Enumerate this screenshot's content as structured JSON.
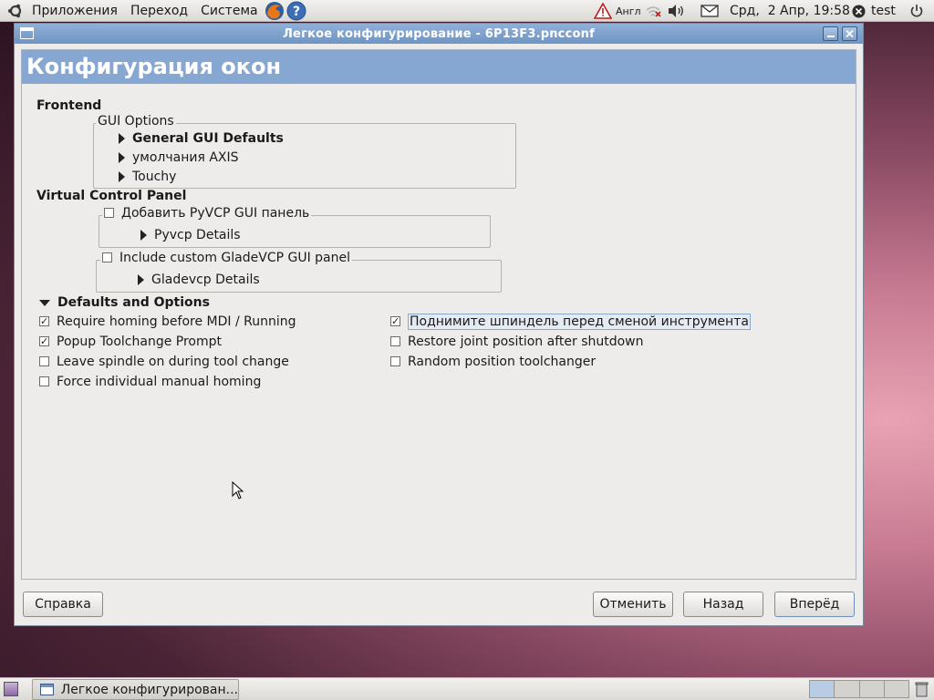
{
  "top_panel": {
    "menus": [
      "Приложения",
      "Переход",
      "Система"
    ],
    "keyboard_layout": "Англ",
    "datetime": "Срд,  2 Апр, 19:58",
    "user": "test"
  },
  "window": {
    "title": "Легкое конфигурирование - 6P13F3.pncconf",
    "page_title": "Конфигурация окон",
    "frontend": {
      "heading": "Frontend",
      "gui_options_label": "GUI Options",
      "expanders": [
        "General GUI Defaults",
        "умолчания AXIS",
        "Touchy"
      ]
    },
    "vcp": {
      "heading": "Virtual Control Panel",
      "pyvcp_check_label": "Добавить PyVCP GUI панель",
      "pyvcp_details": "Pyvcp Details",
      "gladevcp_check_label": "Include custom GladeVCP GUI panel",
      "gladevcp_details": "Gladevcp Details"
    },
    "defaults": {
      "heading": "Defaults and Options",
      "left_options": [
        {
          "label": "Require homing before MDI / Running",
          "checked": true
        },
        {
          "label": "Popup Toolchange Prompt",
          "checked": true
        },
        {
          "label": "Leave spindle on during tool change",
          "checked": false
        },
        {
          "label": "Force individual manual homing",
          "checked": false
        }
      ],
      "right_options": [
        {
          "label": "Поднимите шпиндель перед сменой инструмента",
          "checked": true
        },
        {
          "label": "Restore joint position after shutdown",
          "checked": false
        },
        {
          "label": "Random position toolchanger",
          "checked": false
        }
      ]
    },
    "buttons": {
      "help": "Справка",
      "cancel": "Отменить",
      "back": "Назад",
      "forward": "Вперёд"
    }
  },
  "bottom_panel": {
    "task_label": "Легкое конфигурирован..."
  }
}
